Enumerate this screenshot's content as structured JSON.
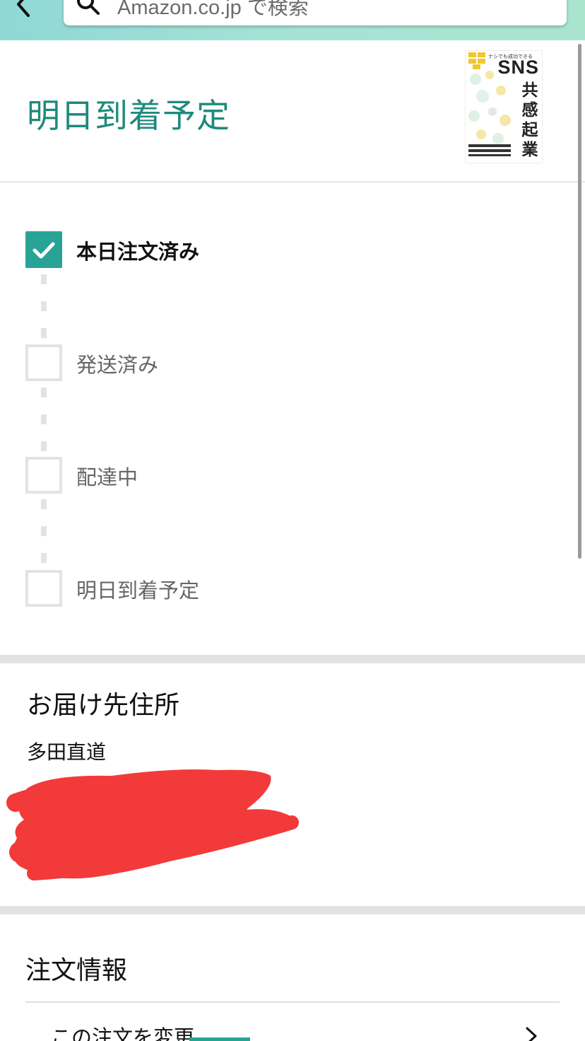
{
  "search": {
    "placeholder": "Amazon.co.jp で検索",
    "icons": {
      "back": "back-arrow-icon",
      "search": "search-icon",
      "camera": "camera-scan-icon",
      "mic": "microphone-icon"
    }
  },
  "status": {
    "title": "明日到着予定",
    "product": {
      "cover_main": "SNS",
      "cover_vertical": "共感起業",
      "cover_tagline": "ナシでも成功できる"
    }
  },
  "steps": [
    {
      "label": "本日注文済み",
      "done": true
    },
    {
      "label": "発送済み",
      "done": false
    },
    {
      "label": "配達中",
      "done": false
    },
    {
      "label": "明日到着予定",
      "done": false
    }
  ],
  "address": {
    "title": "お届け先住所",
    "recipient": "多田直道"
  },
  "order_info": {
    "title": "注文情報",
    "change_order": "この注文を変更"
  },
  "colors": {
    "accent": "#2aa397",
    "title_teal": "#1e8a7d",
    "header_gradient_start": "#8fd8d4",
    "header_gradient_end": "#a9e4cf",
    "redaction": "#f23a3a",
    "separator": "#e3e3e3"
  }
}
